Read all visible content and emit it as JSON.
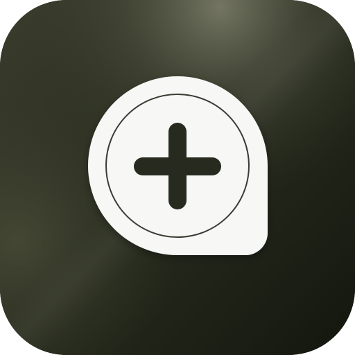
{
  "app_icon": {
    "name": "add-location-app",
    "glyph": "plus-icon",
    "badge_shape": "speech-bubble-pin",
    "colors": {
      "background_dark": "#1a1f13",
      "background_mid": "#2b3022",
      "background_light": "#5f6150",
      "badge_fill": "#f7f8f6",
      "ring_stroke": "#3a3d33",
      "plus_fill": "#262a1f"
    }
  }
}
